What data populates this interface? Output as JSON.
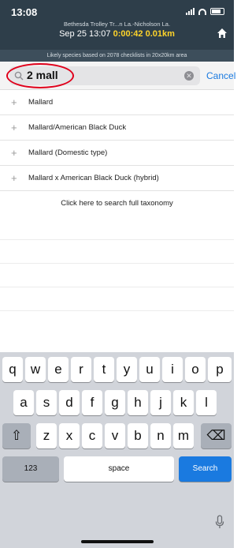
{
  "status": {
    "time": "13:08"
  },
  "header": {
    "location": "Bethesda Trolley Tr...n La.-Nicholson La.",
    "date": "Sep 25 13:07",
    "duration": "0:00:42",
    "distance": "0.01km",
    "likely_species": "Likely species based on 2078 checklists in 20x20km area"
  },
  "search": {
    "value": "2 mall",
    "cancel_label": "Cancel",
    "clear_symbol": "✕"
  },
  "results": [
    {
      "name": "Mallard"
    },
    {
      "name": "Mallard/American Black Duck"
    },
    {
      "name": "Mallard (Domestic type)"
    },
    {
      "name": "Mallard x American Black Duck (hybrid)"
    }
  ],
  "full_taxonomy_label": "Click here to search full taxonomy",
  "keyboard": {
    "row1": [
      "q",
      "w",
      "e",
      "r",
      "t",
      "y",
      "u",
      "i",
      "o",
      "p"
    ],
    "row2": [
      "a",
      "s",
      "d",
      "f",
      "g",
      "h",
      "j",
      "k",
      "l"
    ],
    "row3": [
      "z",
      "x",
      "c",
      "v",
      "b",
      "n",
      "m"
    ],
    "numbers_label": "123",
    "space_label": "space",
    "search_label": "Search",
    "shift_symbol": "⇧",
    "delete_symbol": "⌫"
  },
  "colors": {
    "accent": "#1a7ae0",
    "header": "#2e3e4a",
    "timer": "#ffd42a",
    "highlight": "#e0001b"
  }
}
